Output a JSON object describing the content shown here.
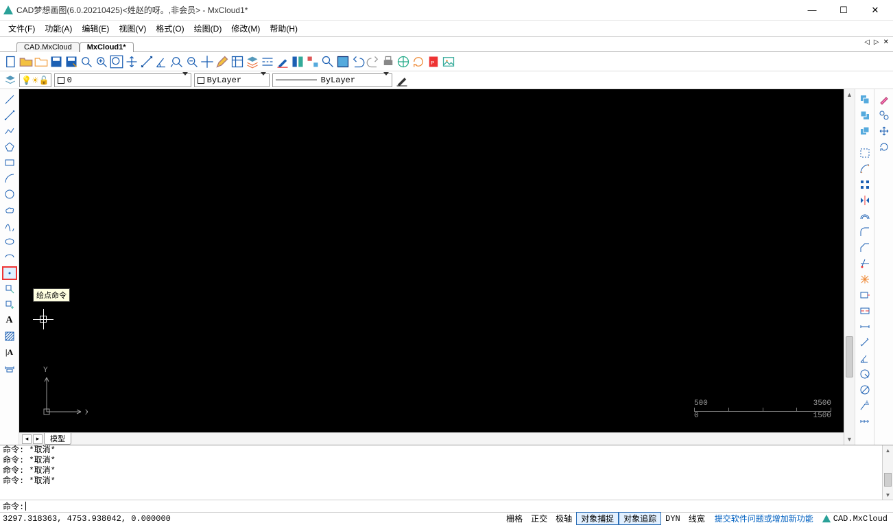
{
  "window": {
    "title": "CAD梦想画图(6.0.20210425)<姓赵的呀。,非会员> - MxCloud1*"
  },
  "menu": {
    "items": [
      "文件(F)",
      "功能(A)",
      "编辑(E)",
      "视图(V)",
      "格式(O)",
      "绘图(D)",
      "修改(M)",
      "帮助(H)"
    ]
  },
  "tabs": {
    "items": [
      "CAD.MxCloud",
      "MxCloud1*"
    ],
    "active_index": 1
  },
  "layer": {
    "name": "0",
    "color_label": "ByLayer",
    "linetype_label": "ByLayer"
  },
  "tooltip": "绘点命令",
  "ucs": {
    "x": "X",
    "y": "Y"
  },
  "ruler": {
    "top_left": "500",
    "top_right": "3500",
    "bottom_left": "0",
    "bottom_right": "1500"
  },
  "model_tab": "模型",
  "command": {
    "history": [
      "命令:  *取消*",
      "命令:  *取消*",
      "命令:  *取消*",
      "命令:  *取消*"
    ],
    "prompt": "命令:",
    "input": ""
  },
  "status": {
    "coords": "3297.318363,  4753.938042,  0.000000",
    "grid": "栅格",
    "ortho": "正交",
    "polar": "极轴",
    "osnap": "对象捕捉",
    "otrack": "对象追踪",
    "dyn": "DYN",
    "lwt": "线宽",
    "feedback": "提交软件问题或增加新功能",
    "brand": "CAD.MxCloud"
  }
}
